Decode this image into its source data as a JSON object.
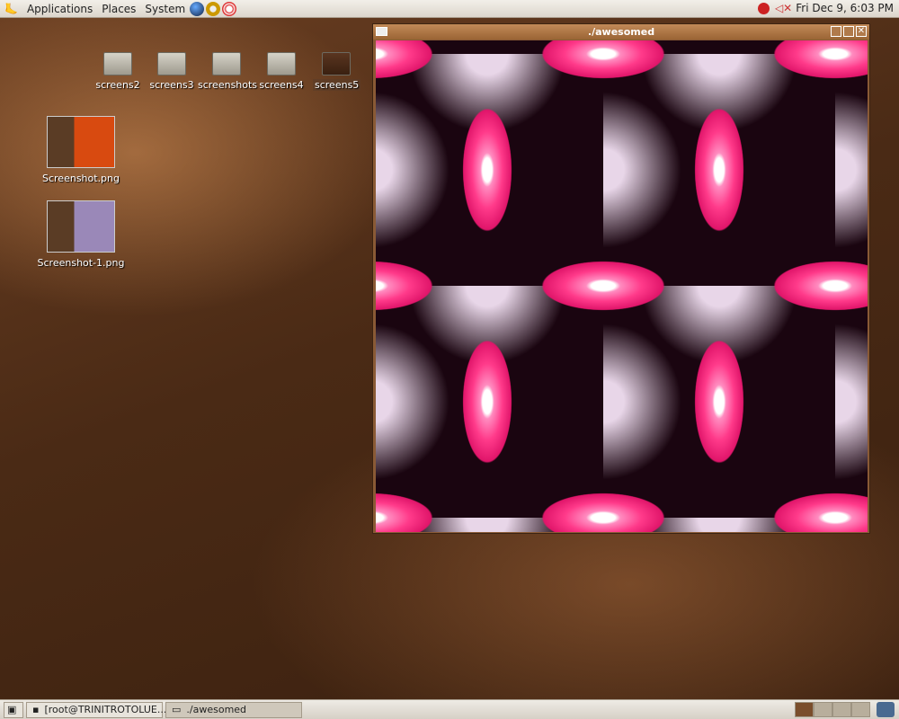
{
  "top_panel": {
    "menus": [
      "Applications",
      "Places",
      "System"
    ],
    "clock": "Fri Dec  9,  6:03 PM"
  },
  "desktop_icons": [
    {
      "label": "screens2",
      "type": "folder"
    },
    {
      "label": "screens3",
      "type": "folder"
    },
    {
      "label": "screenshots",
      "type": "folder"
    },
    {
      "label": "screens4",
      "type": "folder"
    },
    {
      "label": "screens5",
      "type": "folder"
    },
    {
      "label": "Screenshot.png",
      "type": "image"
    },
    {
      "label": "Screenshot-1.png",
      "type": "image"
    }
  ],
  "window": {
    "title": "./awesomed"
  },
  "taskbar": {
    "items": [
      {
        "label": "[root@TRINITROTOLUE..."
      },
      {
        "label": "./awesomed"
      }
    ],
    "workspaces": 4,
    "active_workspace": 1
  }
}
